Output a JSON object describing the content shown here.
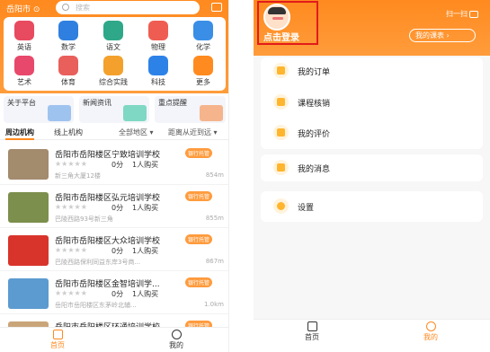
{
  "left": {
    "city": "岳阳市 ⊙",
    "search_placeholder": "搜索",
    "categories": [
      {
        "label": "英语",
        "color": "#e84a5f"
      },
      {
        "label": "数学",
        "color": "#2f7fe0"
      },
      {
        "label": "语文",
        "color": "#2fa889"
      },
      {
        "label": "物理",
        "color": "#ef5d52"
      },
      {
        "label": "化学",
        "color": "#3a8ee6"
      },
      {
        "label": "艺术",
        "color": "#e8486b"
      },
      {
        "label": "体育",
        "color": "#e85f5c"
      },
      {
        "label": "综合实践",
        "color": "#f3a12c"
      },
      {
        "label": "科技",
        "color": "#2d82e8"
      },
      {
        "label": "更多",
        "color": "#ff8a1f"
      }
    ],
    "promos": [
      "关于平台",
      "新闻资讯",
      "重点提醒"
    ],
    "tabs": {
      "nearby": "周边机构",
      "online": "线上机构",
      "region": "全部地区 ▾",
      "sort": "距离从近到远 ▾"
    },
    "orgs": [
      {
        "name": "岳阳市岳阳楼区宁致培训学校",
        "score": "0分",
        "bought": "1人购买",
        "addr": "新三角大厦12楼",
        "dist": "854m",
        "badge": "银行托管",
        "thumb": "#a38b6e"
      },
      {
        "name": "岳阳市岳阳楼区弘元培训学校",
        "score": "0分",
        "bought": "1人购买",
        "addr": "巴陵西路93号新三角",
        "dist": "855m",
        "badge": "银行托管",
        "thumb": "#7c8f4d"
      },
      {
        "name": "岳阳市岳阳楼区大众培训学校",
        "score": "0分",
        "bought": "1人购买",
        "addr": "巴陵西路保利同益东岸3号商...",
        "dist": "867m",
        "badge": "银行托管",
        "thumb": "#d8342c"
      },
      {
        "name": "岳阳市岳阳楼区金智培训学...",
        "score": "0分",
        "bought": "1人购买",
        "addr": "岳阳市岳阳楼区东茅岭北辅...",
        "dist": "1.0km",
        "badge": "银行托管",
        "thumb": "#5b9bd0"
      },
      {
        "name": "岳阳市岳阳楼区环通培训学校",
        "score": "",
        "bought": "",
        "addr": "",
        "dist": "",
        "badge": "银行托管",
        "thumb": "#c9a57a"
      }
    ],
    "nav": {
      "home": "首页",
      "mine": "我的"
    }
  },
  "right": {
    "login": "点击登录",
    "scan": "扫一扫",
    "schedule": "我的课表 ›",
    "menu1": [
      "我的订单",
      "课程核销",
      "我的评价"
    ],
    "menu2": "我的消息",
    "menu3": "设置",
    "nav": {
      "home": "首页",
      "mine": "我的"
    }
  },
  "colors": {
    "accent": "#ff8a1f",
    "highlight": "#e21b1b"
  }
}
